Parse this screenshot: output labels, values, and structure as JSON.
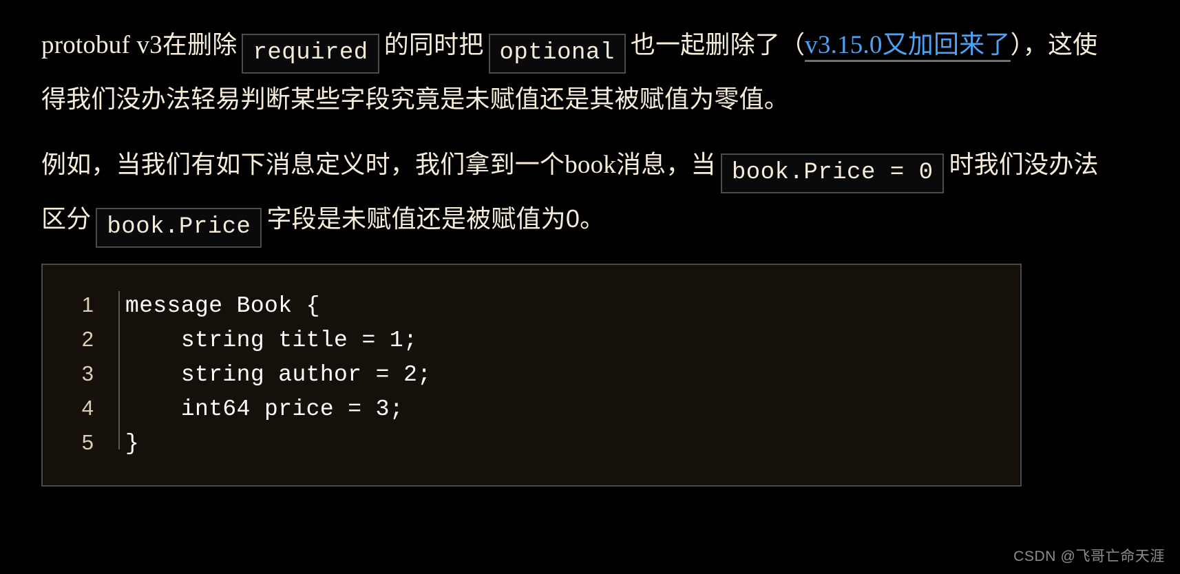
{
  "theme": {
    "background": "#000000",
    "text_color": "#f6ecd9",
    "link_color": "#4ea2f2",
    "link_underline_color": "#6f6f6f",
    "inline_code_bg": "#0a0a0c",
    "inline_code_border": "#4c4c4c",
    "code_block_bg": "#16100b",
    "code_block_border": "#4a4a4a",
    "line_number_color": "#d9cfb4",
    "code_text_color": "#ffffff",
    "watermark_color": "#8d8d8d"
  },
  "paragraphs": {
    "p1": {
      "seg1_latin": "protobuf v3",
      "seg2_cjk": "在删除",
      "code1": "required",
      "seg3_cjk": "的同时把",
      "code2": "optional",
      "seg4_cjk": "也一起删除了（",
      "link_latin": "v3.15.0",
      "link_cjk": "又加回来了",
      "seg5_cjk": "），这使得我们没办法轻易判断某些字段究竟是未赋值还是其被赋值为零值。"
    },
    "p2": {
      "seg1_cjk": "例如，当我们有如下消息定义时，我们拿到一个",
      "seg2_latin": "book",
      "seg3_cjk": "消息，当",
      "code1": "book.Price = 0",
      "seg4_cjk": "时我们没办法区分",
      "code2": "book.Price",
      "seg5_cjk": "字段是未赋值还是被赋值为0。"
    }
  },
  "code_block": {
    "language": "protobuf",
    "lines": [
      {
        "number": "1",
        "text": "message Book {"
      },
      {
        "number": "2",
        "text": "    string title = 1;"
      },
      {
        "number": "3",
        "text": "    string author = 2;"
      },
      {
        "number": "4",
        "text": "    int64 price = 3;"
      },
      {
        "number": "5",
        "text": "}"
      }
    ]
  },
  "watermark": {
    "text": "CSDN @飞哥亡命天涯"
  }
}
